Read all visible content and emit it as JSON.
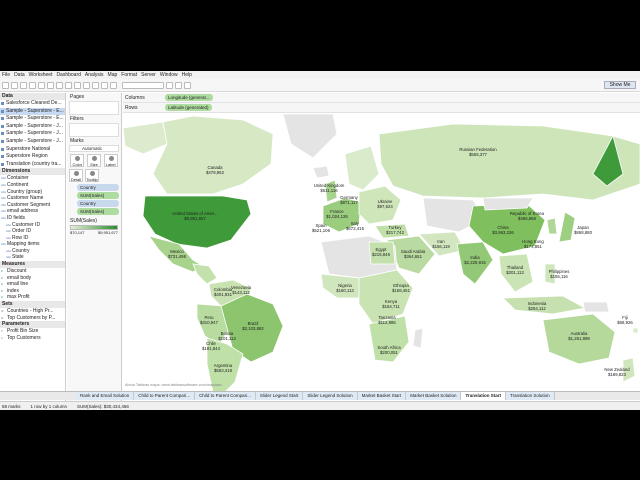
{
  "menu": [
    "File",
    "Data",
    "Worksheet",
    "Dashboard",
    "Analysis",
    "Map",
    "Format",
    "Server",
    "Window",
    "Help"
  ],
  "toolbar": {
    "show_me": "Show Me"
  },
  "data_pane": {
    "header": "Data",
    "sources": [
      "Salesforce Cleaned De...",
      "Sample - Superstore - E...",
      "Sample - Superstore - E...",
      "Sample - Superstore - J...",
      "Sample - Superstore - J...",
      "Sample - Superstore - J...",
      "Superstore National",
      "Superstore Region",
      "Translation (country tra..."
    ],
    "dimensions_header": "Dimensions",
    "dimensions": [
      "Container",
      "Continent",
      "Country (group)",
      "Customer Name",
      "Customer Segment",
      "email address",
      "ID fields",
      "Customer ID",
      "Order ID",
      "Row ID",
      "Mapping items",
      "Country",
      "State"
    ],
    "measures_header": "Measures",
    "measures": [
      "Discount",
      "email body",
      "email line",
      "index",
      "max Profit"
    ],
    "sets_header": "Sets",
    "sets": [
      "Countries - High Pr...",
      "Top Customers by P..."
    ],
    "parameters_header": "Parameters",
    "parameters": [
      "Profit Bin Size",
      "Top Customers"
    ]
  },
  "cards": {
    "pages": "Pages",
    "filters": "Filters",
    "marks": "Marks",
    "mark_type": "Automatic",
    "buttons": [
      "Color",
      "Size",
      "Label",
      "Detail",
      "Tooltip"
    ],
    "pills": [
      "Country",
      "SUM(Sales)",
      "Country",
      "SUM(Sales)"
    ],
    "legend_title": "SUM(Sales)",
    "legend_min": "$70,147",
    "legend_max": "$9,951,677"
  },
  "shelves": {
    "columns_label": "Columns",
    "columns_pill": "Longitude (generat...",
    "rows_label": "Rows",
    "rows_pill": "Latitude (generated)"
  },
  "map_labels": [
    "Russian Federation\n$555,377",
    "United States of Amer...\n$9,951,657",
    "China\n$3,963,226",
    "India\n$2,229,915",
    "Brazil\n$2,103,882",
    "Argentina\n$593,418",
    "Colombia\n$401,931",
    "Peru\n$310,947",
    "Chile\n$181,844",
    "Mexico\n$731,498",
    "Australia\n$1,261,898",
    "New Zealand\n$189,823",
    "South Africa\n$200,051",
    "Fiji\n$68,926",
    "Canada\n$478,962",
    "Republic of Korea\n$466,858",
    "Japan\n$868,880",
    "Hong Kong\n$174,851",
    "Thailand\n$201,113",
    "Saudi Arabia\n$364,651",
    "Egypt\n$215,846",
    "Ethiopia\n$158,451",
    "Kenya\n$154,711",
    "Tanzania\n$112,886",
    "Nigeria\n$160,113",
    "Turkey\n$217,742",
    "Iran\n$156,119",
    "Germany\n$871,117",
    "France\n$1,024,126",
    "United Kingdom\n$611,116",
    "Italy\n$672,415",
    "Spain\n$521,106",
    "Ukraine\n$97,624",
    "Venezuela\n$143,112",
    "Bolivia\n$101,113",
    "Indonesia\n$254,112",
    "Philippines\n$155,116"
  ],
  "map_attribution": "About Tableau maps: www.tableausoftware.com/mapdata",
  "tabs": [
    "Rank and Email Solution",
    "Child to Parent Compari...",
    "Child to Parent Compari...",
    "Slider Legend Start",
    "Slider Legend Solution",
    "Market Basket Start",
    "Market Basket Solution",
    "Translation Start",
    "Translation Solution"
  ],
  "active_tab": "Translation Start",
  "status": {
    "marks": "58 marks",
    "rows": "1 row by 1 column",
    "sum": "SUM(Sales): $30,434,456"
  },
  "colors": {
    "map_low": "#e3f0d6",
    "map_high": "#2e8b2e",
    "no_data": "#e4e4e4",
    "border": "#ffffff",
    "selected_source": "#c6d9f0"
  }
}
